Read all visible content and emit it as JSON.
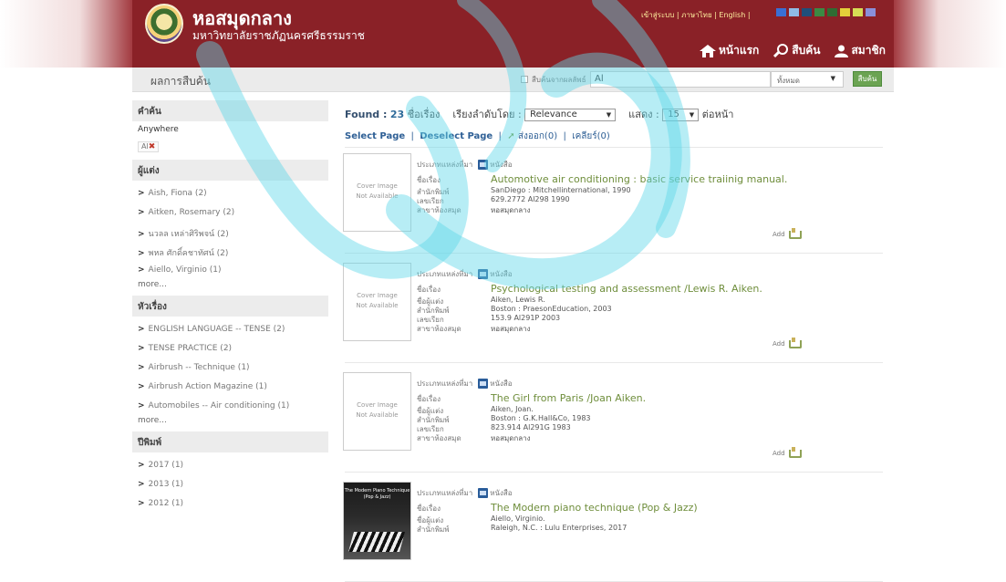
{
  "header": {
    "site_title": "หอสมุดกลาง",
    "site_subtitle": "มหาวิทยาลัยราชภัฏนครศรีธรรมราช",
    "top_links": "เข้าสู่ระบบ | ภาษาไทย | English |",
    "theme_colors": [
      "#3a6fd4",
      "#8fbce6",
      "#1f4f7a",
      "#3b8a43",
      "#2f6b33",
      "#e3cf3a",
      "#d7dd55",
      "#8a8fd9"
    ],
    "nav": {
      "home": "หน้าแรก",
      "search": "สืบค้น",
      "member": "สมาชิก"
    }
  },
  "subbar": {
    "page_title": "ผลการสืบค้น",
    "only_checkbox_label": "สืบค้นจากผลลัพธ์",
    "search_value": "Al",
    "scope": "ทั้งหมด",
    "search_button": "สืบค้น"
  },
  "sidebar": {
    "keyword_header": "คำค้น",
    "anywhere_label": "Anywhere",
    "chip": "Al",
    "author_header": "ผู้แต่ง",
    "authors": [
      "Aish, Fiona (2)",
      "Aitken, Rosemary (2)",
      "นวลล เหล่าศิริพจน์ (2)",
      "พหล ศักดิ์คชาทัศน์ (2)",
      "Aiello, Virginio (1)"
    ],
    "more_authors": "more...",
    "subject_header": "หัวเรื่อง",
    "subjects": [
      "ENGLISH LANGUAGE -- TENSE (2)",
      "TENSE PRACTICE (2)",
      "Airbrush -- Technique (1)",
      "Airbrush Action Magazine (1)",
      "Automobiles -- Air conditioning (1)"
    ],
    "more_subjects": "more...",
    "year_header": "ปีพิมพ์",
    "years": [
      "2017 (1)",
      "2013 (1)",
      "2012 (1)"
    ]
  },
  "results": {
    "found_label": "Found :",
    "found_count": "23",
    "found_unit": "ชื่อเรื่อง",
    "sort_label": "เรียงลำดับโดย :",
    "sort_value": "Relevance",
    "show_label": "แสดง :",
    "show_value": "15",
    "per_page_label": "ต่อหน้า",
    "select_page": "Select Page",
    "deselect_page": "Deselect Page",
    "export": "ส่งออก(0)",
    "clear": "เคลียร์(0)",
    "cover_placeholder_1": "Cover Image",
    "cover_placeholder_2": "Not Available",
    "type_label": "ประเภทแหล่งที่มา",
    "type_value": "หนังสือ",
    "add_label": "Add",
    "labels": {
      "title": "ชื่อเรื่อง",
      "author": "ชื่อผู้แต่ง",
      "publisher": "สำนักพิมพ์",
      "callno": "เลขเรียก",
      "branch": "สาขาห้องสมุด"
    },
    "records": [
      {
        "title": "Automotive air conditioning : basic service traiinig manual.",
        "publisher": "SanDiego : Mitchellinternational, 1990",
        "callno": "629.2772 Al298 1990",
        "branch": "หอสมุดกลาง"
      },
      {
        "title": "Psychological testing and assessment /Lewis R. Aiken.",
        "author": "Aiken, Lewis R.",
        "publisher": "Boston : PraesonEducation, 2003",
        "callno": "153.9 Al291P 2003",
        "branch": "หอสมุดกลาง"
      },
      {
        "title": "The Girl from Paris /Joan Aiken.",
        "author": "Aiken, Joan.",
        "publisher": "Boston : G.K.Hall&Co, 1983",
        "callno": "823.914 Al291G 1983",
        "branch": "หอสมุดกลาง"
      },
      {
        "title": "The Modern piano technique (Pop & Jazz)",
        "author": "Aiello, Virginio.",
        "publisher": "Raleigh, N.C. : Lulu Enterprises, 2017",
        "cover_text": "The Modern Piano Technique (Pop & Jazz)"
      }
    ]
  }
}
